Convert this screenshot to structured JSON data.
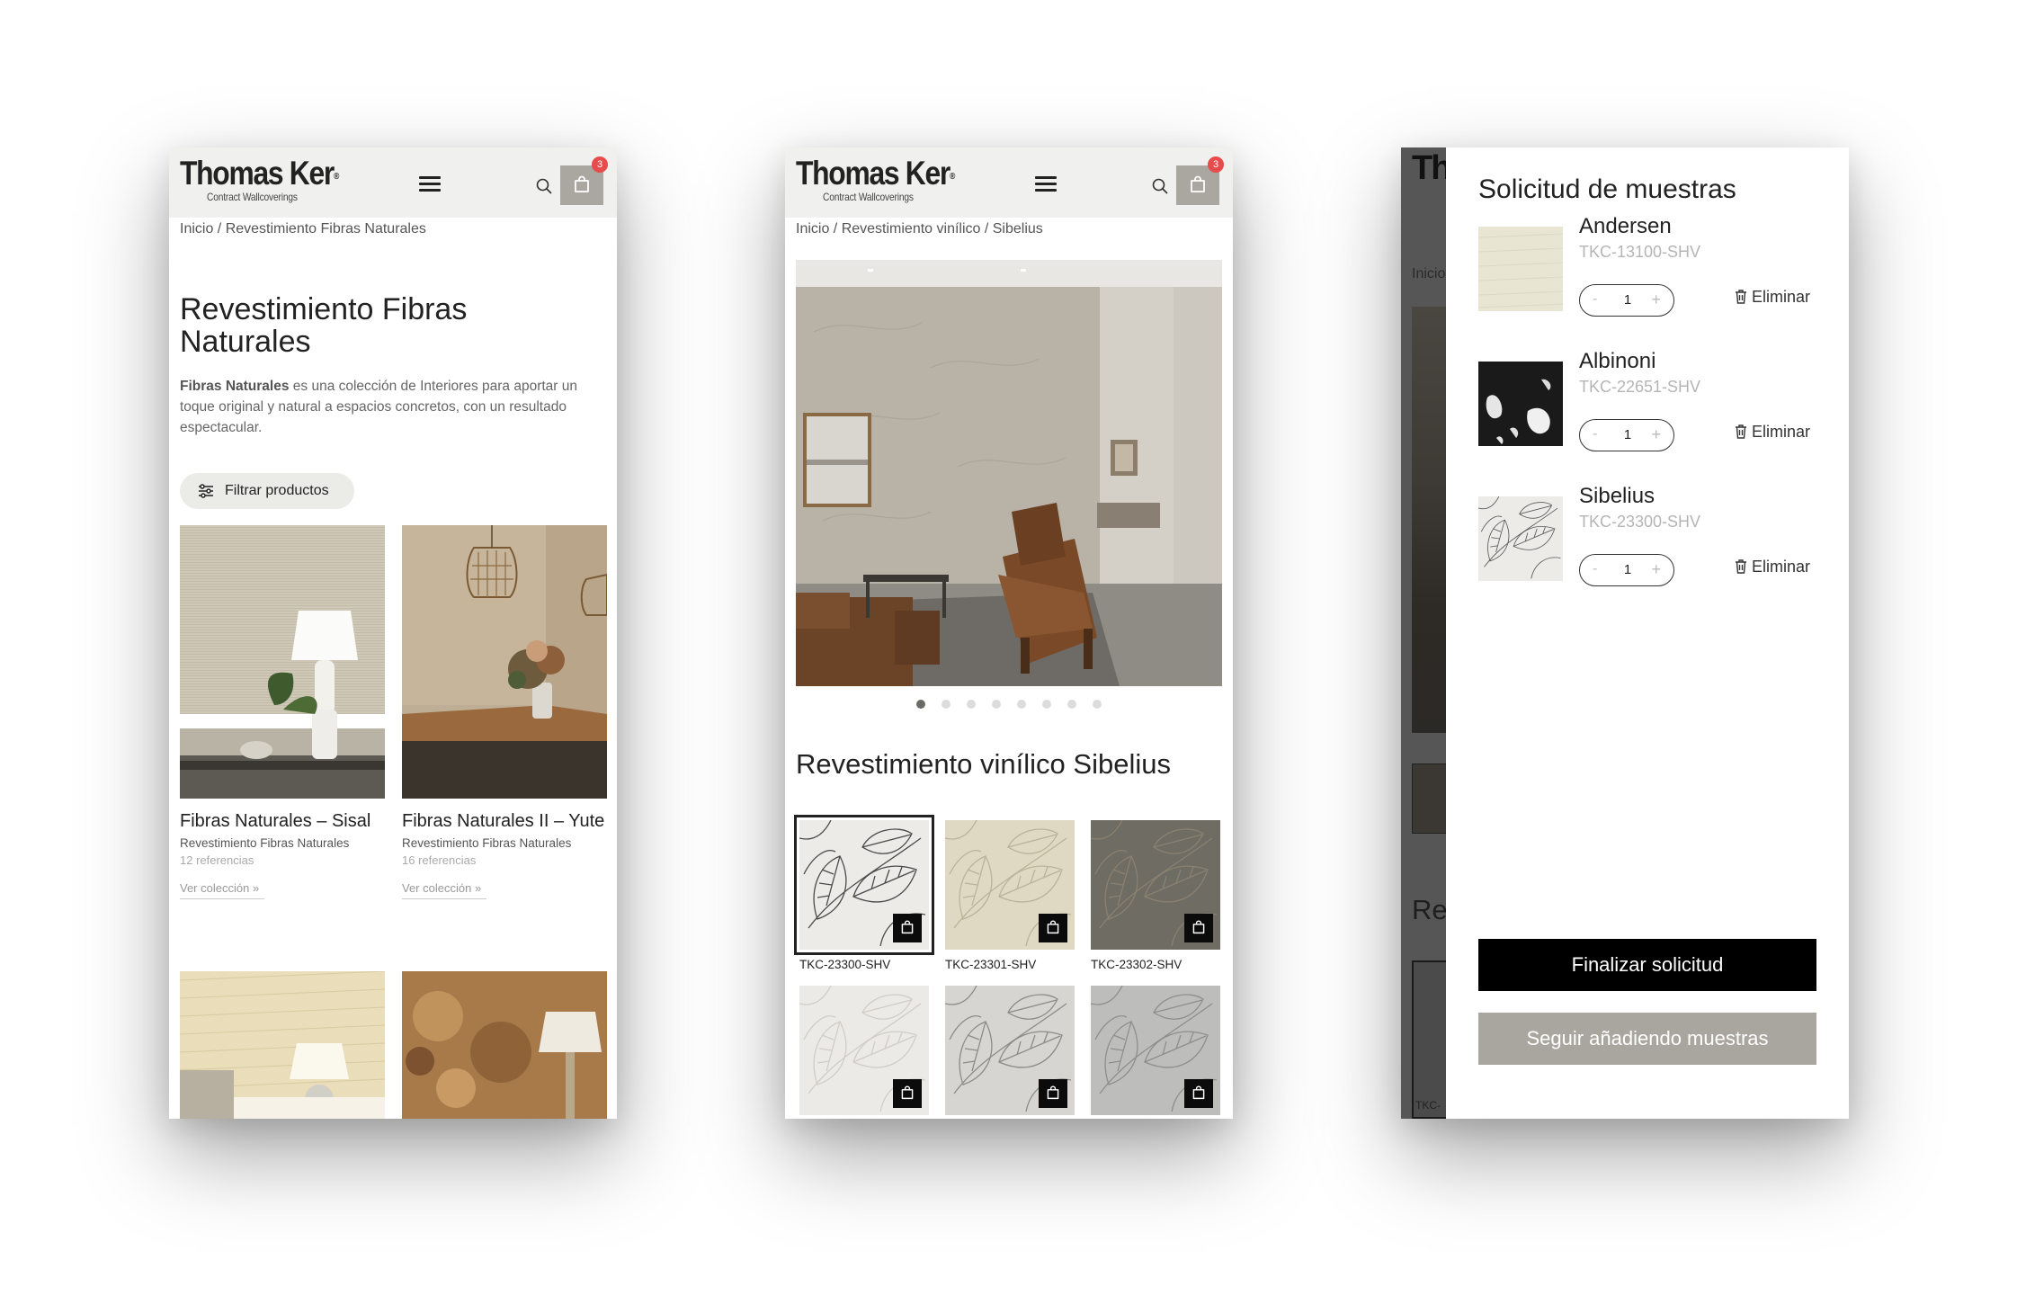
{
  "brand": {
    "name": "Thomas Ker",
    "registered": "®",
    "tagline": "Contract Wallcoverings"
  },
  "header": {
    "cart_count": "3"
  },
  "screen1": {
    "breadcrumb": "Inicio / Revestimiento Fibras Naturales",
    "title": "Revestimiento Fibras Naturales",
    "description_bold": "Fibras Naturales",
    "description_rest": " es una colección de Interiores para aportar un toque original y natural a espacios concretos, con un resultado espectacular.",
    "filter_label": "Filtrar productos",
    "collections": [
      {
        "title": "Fibras Naturales – Sisal",
        "category": "Revestimiento Fibras Naturales",
        "refs": "12 referencias",
        "link": "Ver colección"
      },
      {
        "title": "Fibras Naturales II – Yute",
        "category": "Revestimiento Fibras Naturales",
        "refs": "16 referencias",
        "link": "Ver colección"
      }
    ]
  },
  "screen2": {
    "breadcrumb": "Inicio / Revestimiento vinílico / Sibelius",
    "title": "Revestimiento vinílico Sibelius",
    "slider": {
      "count": 8,
      "active": 0
    },
    "swatches": [
      {
        "code": "TKC-23300-SHV",
        "selected": true
      },
      {
        "code": "TKC-23301-SHV",
        "selected": false
      },
      {
        "code": "TKC-23302-SHV",
        "selected": false
      }
    ]
  },
  "screen3": {
    "background_breadcrumb": "Inicio",
    "background_title": "Re",
    "background_code": "TKC-",
    "drawer_title": "Solicitud de muestras",
    "items": [
      {
        "name": "Andersen",
        "code": "TKC-13100-SHV",
        "qty": "1",
        "remove": "Eliminar"
      },
      {
        "name": "Albinoni",
        "code": "TKC-22651-SHV",
        "qty": "1",
        "remove": "Eliminar"
      },
      {
        "name": "Sibelius",
        "code": "TKC-23300-SHV",
        "qty": "1",
        "remove": "Eliminar"
      }
    ],
    "finalize_label": "Finalizar solicitud",
    "continue_label": "Seguir añadiendo muestras"
  }
}
